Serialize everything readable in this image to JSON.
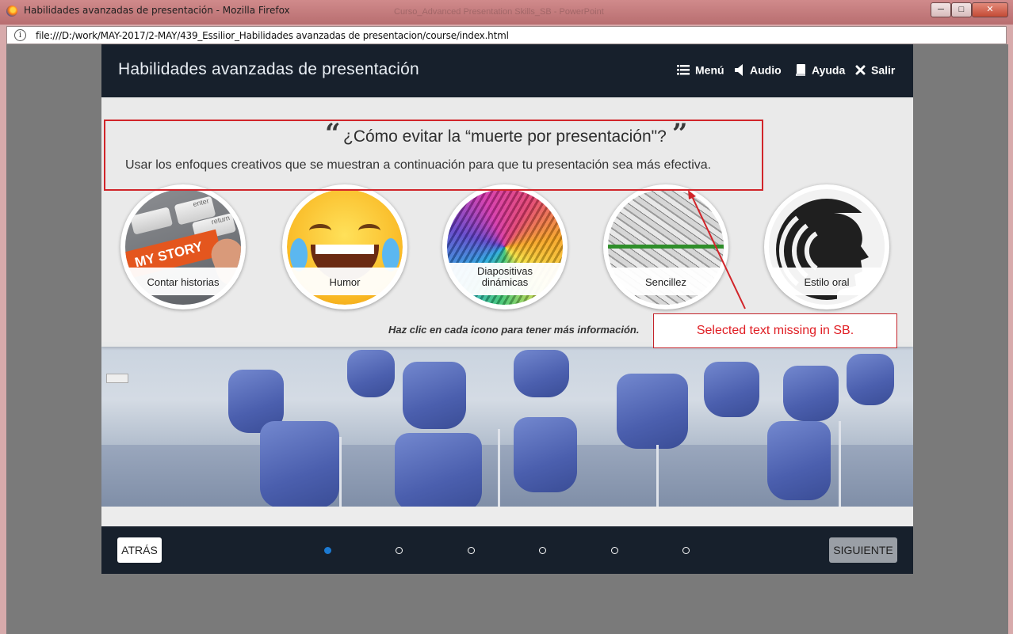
{
  "window": {
    "title": "Habilidades avanzadas de presentación - Mozilla Firefox",
    "background_title": "Curso_Advanced Presentation Skills_SB - PowerPoint",
    "url": "file:///D:/work/MAY-2017/2-MAY/439_Essilior_Habilidades avanzadas de presentacion/course/index.html",
    "minimize": "─",
    "maximize": "□",
    "close": "✕"
  },
  "course": {
    "title": "Habilidades avanzadas de presentación",
    "nav": {
      "menu": "Menú",
      "audio": "Audio",
      "help": "Ayuda",
      "exit": "Salir"
    },
    "open_quote": "“",
    "close_quote": "”",
    "headline": "¿Cómo evitar la “muerte por presentación\"?",
    "subline": "Usar los enfoques creativos que se muestran a continuación para que tu presentación sea más efectiva.",
    "topics": [
      {
        "label": "Contar historias",
        "image_text": "MY STORY",
        "key_a": "enter",
        "key_b": "return"
      },
      {
        "label": "Humor"
      },
      {
        "label_line1": "Diapositivas",
        "label_line2": "dinámicas"
      },
      {
        "label": "Sencillez"
      },
      {
        "label": "Estilo oral"
      }
    ],
    "hint": "Haz clic en cada icono para tener más información.",
    "footer": {
      "back": "ATRÁS",
      "next": "SIGUIENTE",
      "active_page": 1,
      "pages": 6
    }
  },
  "annotation": {
    "note": "Selected text missing in SB.",
    "color": "#d1252a"
  }
}
